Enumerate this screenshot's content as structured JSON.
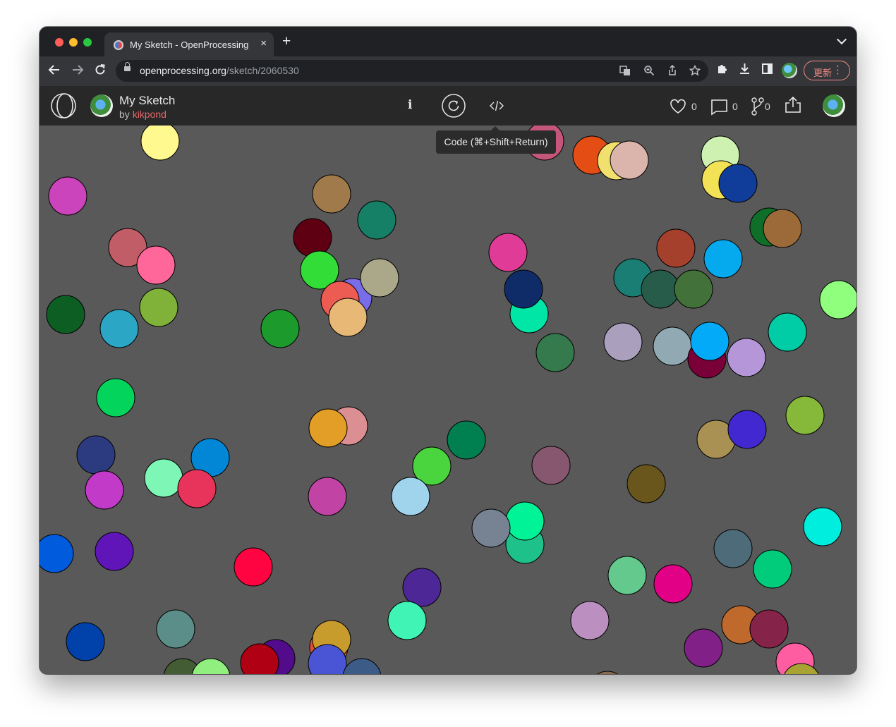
{
  "browser": {
    "tab_title": "My Sketch - OpenProcessing",
    "tab_close": "×",
    "new_tab": "+",
    "url_domain": "openprocessing.org",
    "url_path": "/sketch/2060530",
    "update_label": "更新",
    "more": "⋮"
  },
  "header": {
    "sketch_title": "My Sketch",
    "by_label": "by",
    "author": "kikpond",
    "info_label": "i",
    "like_count": "0",
    "comment_count": "0",
    "fork_count": "0"
  },
  "tooltip": {
    "text": "Code (⌘+Shift+Return)"
  },
  "canvas": {
    "background": "#595959",
    "circles": [
      {
        "c": "#fff98f"
      },
      {
        "c": "#cc44bb"
      },
      {
        "c": "#a07a4a"
      },
      {
        "c": "#158066"
      },
      {
        "c": "#5e0011"
      },
      {
        "c": "#31dd36"
      },
      {
        "c": "#c15d66"
      },
      {
        "c": "#ff6699"
      },
      {
        "c": "#7a6de9"
      },
      {
        "c": "#ec5c52"
      },
      {
        "c": "#aba88a"
      },
      {
        "c": "#e8b876"
      },
      {
        "c": "#0c5e22"
      },
      {
        "c": "#2ba6c4"
      },
      {
        "c": "#80b23a"
      },
      {
        "c": "#1c9a2c"
      },
      {
        "c": "#c4567a"
      },
      {
        "c": "#e44e15"
      },
      {
        "c": "#f1df6e"
      },
      {
        "c": "#dbb5ab"
      },
      {
        "c": "#cef1b2"
      },
      {
        "c": "#f4e256"
      },
      {
        "c": "#103d9a"
      },
      {
        "c": "#0f6e28"
      },
      {
        "c": "#9b6a38"
      },
      {
        "c": "#e03c97"
      },
      {
        "c": "#a4402c"
      },
      {
        "c": "#04aaed"
      },
      {
        "c": "#1a7e74"
      },
      {
        "c": "#285c4a"
      },
      {
        "c": "#427239"
      },
      {
        "c": "#00e6a6"
      },
      {
        "c": "#0f2b68"
      },
      {
        "c": "#347a4c"
      },
      {
        "c": "#90ff7e"
      },
      {
        "c": "#aa9fbd"
      },
      {
        "c": "#91a9b3"
      },
      {
        "c": "#7a0038"
      },
      {
        "c": "#03aaf7"
      },
      {
        "c": "#b596d8"
      },
      {
        "c": "#00cca6"
      },
      {
        "c": "#03d55c"
      },
      {
        "c": "#dc8f92"
      },
      {
        "c": "#e29e26"
      },
      {
        "c": "#008050"
      },
      {
        "c": "#4ad43d"
      },
      {
        "c": "#875770"
      },
      {
        "c": "#a89152"
      },
      {
        "c": "#4228d0"
      },
      {
        "c": "#86b93a"
      },
      {
        "c": "#2c3b80"
      },
      {
        "c": "#0287d6"
      },
      {
        "c": "#7ef7b6"
      },
      {
        "c": "#e8345a"
      },
      {
        "c": "#c23ac8"
      },
      {
        "c": "#c144a4"
      },
      {
        "c": "#9fd4ec"
      },
      {
        "c": "#69561c"
      },
      {
        "c": "#1fc18a"
      },
      {
        "c": "#00f497"
      },
      {
        "c": "#778393"
      },
      {
        "c": "#00eedd"
      },
      {
        "c": "#4d6b78"
      },
      {
        "c": "#005cdd"
      },
      {
        "c": "#6015b9"
      },
      {
        "c": "#ff0440"
      },
      {
        "c": "#4e2797"
      },
      {
        "c": "#00cc7c"
      },
      {
        "c": "#63c98c"
      },
      {
        "c": "#e20086"
      },
      {
        "c": "#40f4b5"
      },
      {
        "c": "#bb90c1"
      },
      {
        "c": "#c0692d"
      },
      {
        "c": "#862349"
      },
      {
        "c": "#812086"
      },
      {
        "c": "#5b8e89"
      },
      {
        "c": "#0041aa"
      },
      {
        "c": "#445c34"
      },
      {
        "c": "#90ef7e"
      },
      {
        "c": "#520b8a"
      },
      {
        "c": "#df4f36"
      },
      {
        "c": "#c79c2c"
      },
      {
        "c": "#b00013"
      },
      {
        "c": "#4a55d6"
      },
      {
        "c": "#3c5b86"
      },
      {
        "c": "#ff5da2"
      },
      {
        "c": "#a8a333"
      },
      {
        "c": "#8a6a4b"
      }
    ]
  }
}
